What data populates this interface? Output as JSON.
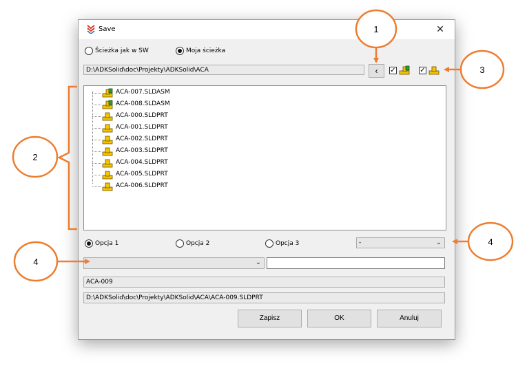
{
  "window": {
    "title": "Save",
    "close_label": "✕"
  },
  "path_mode": {
    "option_sw": "Ścieżka jak w SW",
    "option_own": "Moja ścieżka",
    "selected": "option_own"
  },
  "folder_path": "D:\\ADKSolid\\doc\\Projekty\\ADKSolid\\ACA",
  "back_button_label": "‹",
  "filters": {
    "assembly_checked": true,
    "part_checked": true,
    "check_glyph": "✓"
  },
  "tree": {
    "items": [
      {
        "label": "ACA-007.SLDASM",
        "icon": "assembly-icon"
      },
      {
        "label": "ACA-008.SLDASM",
        "icon": "assembly-icon"
      },
      {
        "label": "ACA-000.SLDPRT",
        "icon": "part-icon"
      },
      {
        "label": "ACA-001.SLDPRT",
        "icon": "part-icon"
      },
      {
        "label": "ACA-002.SLDPRT",
        "icon": "part-icon"
      },
      {
        "label": "ACA-003.SLDPRT",
        "icon": "part-icon"
      },
      {
        "label": "ACA-004.SLDPRT",
        "icon": "part-icon"
      },
      {
        "label": "ACA-005.SLDPRT",
        "icon": "part-icon"
      },
      {
        "label": "ACA-006.SLDPRT",
        "icon": "part-icon"
      }
    ]
  },
  "options": {
    "opcja1": "Opcja 1",
    "opcja2": "Opcja 2",
    "opcja3": "Opcja 3",
    "selected": "opcja1",
    "dropdown_value": "-"
  },
  "name_combo_value": "",
  "name_text_value": "",
  "file_name": "ACA-009",
  "full_path": "D:\\ADKSolid\\doc\\Projekty\\ADKSolid\\ACA\\ACA-009.SLDPRT",
  "buttons": {
    "save": "Zapisz",
    "ok": "OK",
    "cancel": "Anuluj"
  },
  "callouts": {
    "c1": "1",
    "c2": "2",
    "c3": "3",
    "c4a": "4",
    "c4b": "4"
  },
  "colors": {
    "callout_orange": "#ED7D31",
    "part_yellow": "#F5C400",
    "assembly_green": "#2E9B2E"
  }
}
